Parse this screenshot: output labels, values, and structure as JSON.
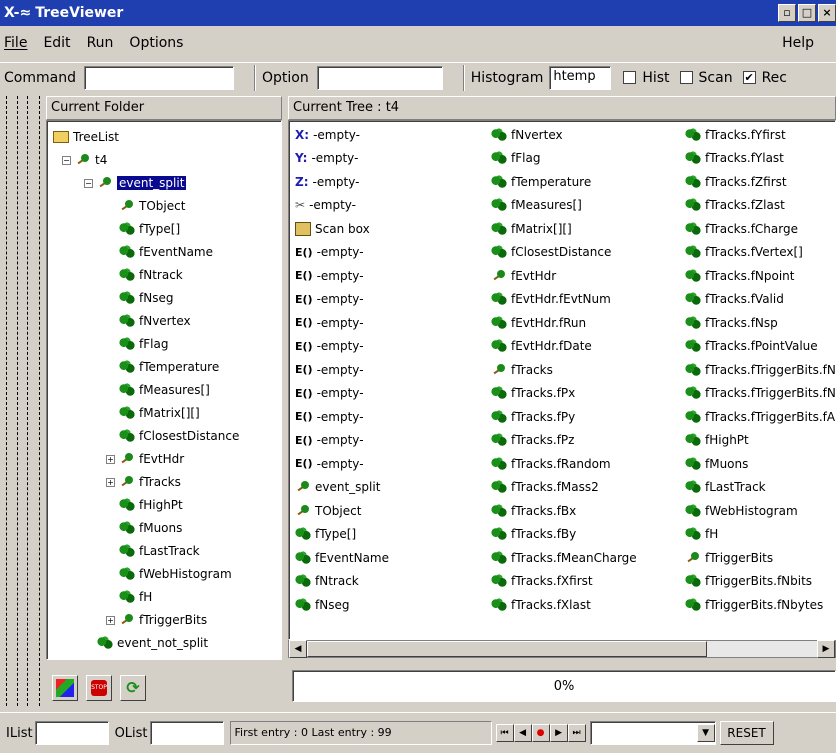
{
  "window": {
    "title": "TreeViewer",
    "logo": "X-≈"
  },
  "menu": [
    "File",
    "Edit",
    "Run",
    "Options"
  ],
  "help_label": "Help",
  "toolbar": {
    "command_label": "Command",
    "command_value": "",
    "option_label": "Option",
    "option_value": "",
    "histogram_label": "Histogram",
    "histogram_value": "htemp",
    "hist_label": "Hist",
    "scan_label": "Scan",
    "rec_label": "Rec",
    "hist_checked": false,
    "scan_checked": false,
    "rec_checked": true
  },
  "left_panel": {
    "header": "Current Folder",
    "tree": [
      {
        "label": "TreeList",
        "icon": "folder-icon",
        "depth": 0
      },
      {
        "label": "t4",
        "icon": "tree-icon",
        "depth": 1,
        "toggle": "−"
      },
      {
        "label": "event_split",
        "icon": "branch-icon",
        "depth": 2,
        "toggle": "−",
        "selected": true
      },
      {
        "label": "TObject",
        "icon": "branch-icon",
        "depth": 3
      },
      {
        "label": "fType[]",
        "icon": "leaf-icon",
        "depth": 3
      },
      {
        "label": "fEventName",
        "icon": "leaf-icon",
        "depth": 3
      },
      {
        "label": "fNtrack",
        "icon": "leaf-icon",
        "depth": 3
      },
      {
        "label": "fNseg",
        "icon": "leaf-icon",
        "depth": 3
      },
      {
        "label": "fNvertex",
        "icon": "leaf-icon",
        "depth": 3
      },
      {
        "label": "fFlag",
        "icon": "leaf-icon",
        "depth": 3
      },
      {
        "label": "fTemperature",
        "icon": "leaf-icon",
        "depth": 3
      },
      {
        "label": "fMeasures[]",
        "icon": "leaf-icon",
        "depth": 3
      },
      {
        "label": "fMatrix[][]",
        "icon": "leaf-icon",
        "depth": 3
      },
      {
        "label": "fClosestDistance",
        "icon": "leaf-icon",
        "depth": 3
      },
      {
        "label": "fEvtHdr",
        "icon": "branch-icon",
        "depth": 3,
        "toggle": "+"
      },
      {
        "label": "fTracks",
        "icon": "branch-icon",
        "depth": 3,
        "toggle": "+"
      },
      {
        "label": "fHighPt",
        "icon": "leaf-icon",
        "depth": 3
      },
      {
        "label": "fMuons",
        "icon": "leaf-icon",
        "depth": 3
      },
      {
        "label": "fLastTrack",
        "icon": "leaf-icon",
        "depth": 3
      },
      {
        "label": "fWebHistogram",
        "icon": "leaf-icon",
        "depth": 3
      },
      {
        "label": "fH",
        "icon": "leaf-icon",
        "depth": 3
      },
      {
        "label": "fTriggerBits",
        "icon": "branch-icon",
        "depth": 3,
        "toggle": "+"
      },
      {
        "label": "event_not_split",
        "icon": "leaf-icon",
        "depth": 2
      }
    ]
  },
  "right_panel": {
    "header": "Current Tree : t4",
    "col1": [
      {
        "prefix": "X:",
        "label": "-empty-",
        "icon": "x-axis-icon"
      },
      {
        "prefix": "Y:",
        "label": "-empty-",
        "icon": "y-axis-icon"
      },
      {
        "prefix": "Z:",
        "label": "-empty-",
        "icon": "z-axis-icon"
      },
      {
        "prefix": "✂",
        "label": "-empty-",
        "icon": "scissors-icon"
      },
      {
        "prefix": "",
        "label": "Scan box",
        "icon": "scan-box-icon"
      },
      {
        "prefix": "E()",
        "label": "-empty-",
        "icon": "expression-icon"
      },
      {
        "prefix": "E()",
        "label": "-empty-",
        "icon": "expression-icon"
      },
      {
        "prefix": "E()",
        "label": "-empty-",
        "icon": "expression-icon"
      },
      {
        "prefix": "E()",
        "label": "-empty-",
        "icon": "expression-icon"
      },
      {
        "prefix": "E()",
        "label": "-empty-",
        "icon": "expression-icon"
      },
      {
        "prefix": "E()",
        "label": "-empty-",
        "icon": "expression-icon"
      },
      {
        "prefix": "E()",
        "label": "-empty-",
        "icon": "expression-icon"
      },
      {
        "prefix": "E()",
        "label": "-empty-",
        "icon": "expression-icon"
      },
      {
        "prefix": "E()",
        "label": "-empty-",
        "icon": "expression-icon"
      },
      {
        "prefix": "E()",
        "label": "-empty-",
        "icon": "expression-icon"
      },
      {
        "prefix": "",
        "label": "event_split",
        "icon": "branch-icon"
      },
      {
        "prefix": "",
        "label": "TObject",
        "icon": "branch-icon"
      },
      {
        "prefix": "",
        "label": "fType[]",
        "icon": "leaf-icon"
      },
      {
        "prefix": "",
        "label": "fEventName",
        "icon": "leaf-icon"
      },
      {
        "prefix": "",
        "label": "fNtrack",
        "icon": "leaf-icon"
      },
      {
        "prefix": "",
        "label": "fNseg",
        "icon": "leaf-icon"
      }
    ],
    "col2": [
      {
        "label": "fNvertex",
        "icon": "leaf-icon"
      },
      {
        "label": "fFlag",
        "icon": "leaf-icon"
      },
      {
        "label": "fTemperature",
        "icon": "leaf-icon"
      },
      {
        "label": "fMeasures[]",
        "icon": "leaf-icon"
      },
      {
        "label": "fMatrix[][]",
        "icon": "leaf-icon"
      },
      {
        "label": "fClosestDistance",
        "icon": "leaf-icon"
      },
      {
        "label": "fEvtHdr",
        "icon": "branch-icon"
      },
      {
        "label": "fEvtHdr.fEvtNum",
        "icon": "leaf-icon"
      },
      {
        "label": "fEvtHdr.fRun",
        "icon": "leaf-icon"
      },
      {
        "label": "fEvtHdr.fDate",
        "icon": "leaf-icon"
      },
      {
        "label": "fTracks",
        "icon": "branch-icon"
      },
      {
        "label": "fTracks.fPx",
        "icon": "leaf-icon"
      },
      {
        "label": "fTracks.fPy",
        "icon": "leaf-icon"
      },
      {
        "label": "fTracks.fPz",
        "icon": "leaf-icon"
      },
      {
        "label": "fTracks.fRandom",
        "icon": "leaf-icon"
      },
      {
        "label": "fTracks.fMass2",
        "icon": "leaf-icon"
      },
      {
        "label": "fTracks.fBx",
        "icon": "leaf-icon"
      },
      {
        "label": "fTracks.fBy",
        "icon": "leaf-icon"
      },
      {
        "label": "fTracks.fMeanCharge",
        "icon": "leaf-icon"
      },
      {
        "label": "fTracks.fXfirst",
        "icon": "leaf-icon"
      },
      {
        "label": "fTracks.fXlast",
        "icon": "leaf-icon"
      }
    ],
    "col3": [
      {
        "label": "fTracks.fYfirst",
        "icon": "leaf-icon"
      },
      {
        "label": "fTracks.fYlast",
        "icon": "leaf-icon"
      },
      {
        "label": "fTracks.fZfirst",
        "icon": "leaf-icon"
      },
      {
        "label": "fTracks.fZlast",
        "icon": "leaf-icon"
      },
      {
        "label": "fTracks.fCharge",
        "icon": "leaf-icon"
      },
      {
        "label": "fTracks.fVertex[]",
        "icon": "leaf-icon"
      },
      {
        "label": "fTracks.fNpoint",
        "icon": "leaf-icon"
      },
      {
        "label": "fTracks.fValid",
        "icon": "leaf-icon"
      },
      {
        "label": "fTracks.fNsp",
        "icon": "leaf-icon"
      },
      {
        "label": "fTracks.fPointValue",
        "icon": "leaf-icon"
      },
      {
        "label": "fTracks.fTriggerBits.fN",
        "icon": "leaf-icon"
      },
      {
        "label": "fTracks.fTriggerBits.fN",
        "icon": "leaf-icon"
      },
      {
        "label": "fTracks.fTriggerBits.fA",
        "icon": "leaf-icon"
      },
      {
        "label": "fHighPt",
        "icon": "leaf-icon"
      },
      {
        "label": "fMuons",
        "icon": "leaf-icon"
      },
      {
        "label": "fLastTrack",
        "icon": "leaf-icon"
      },
      {
        "label": "fWebHistogram",
        "icon": "leaf-icon"
      },
      {
        "label": "fH",
        "icon": "leaf-icon"
      },
      {
        "label": "fTriggerBits",
        "icon": "branch-icon"
      },
      {
        "label": "fTriggerBits.fNbits",
        "icon": "leaf-icon"
      },
      {
        "label": "fTriggerBits.fNbytes",
        "icon": "leaf-icon"
      }
    ]
  },
  "progress": {
    "text": "0%",
    "value": 0
  },
  "statusbar": {
    "ilist_label": "IList",
    "olist_label": "OList",
    "ilist_value": "",
    "olist_value": "",
    "entry_info": "First entry : 0 Last entry : 99",
    "reset_label": "RESET",
    "nav_buttons": [
      "⏮",
      "◀",
      "●",
      "▶",
      "⏭"
    ]
  },
  "colors": {
    "titlebar": "#1f3fb1",
    "selection": "#0a0a90",
    "leaf": "#1a8f1a"
  }
}
